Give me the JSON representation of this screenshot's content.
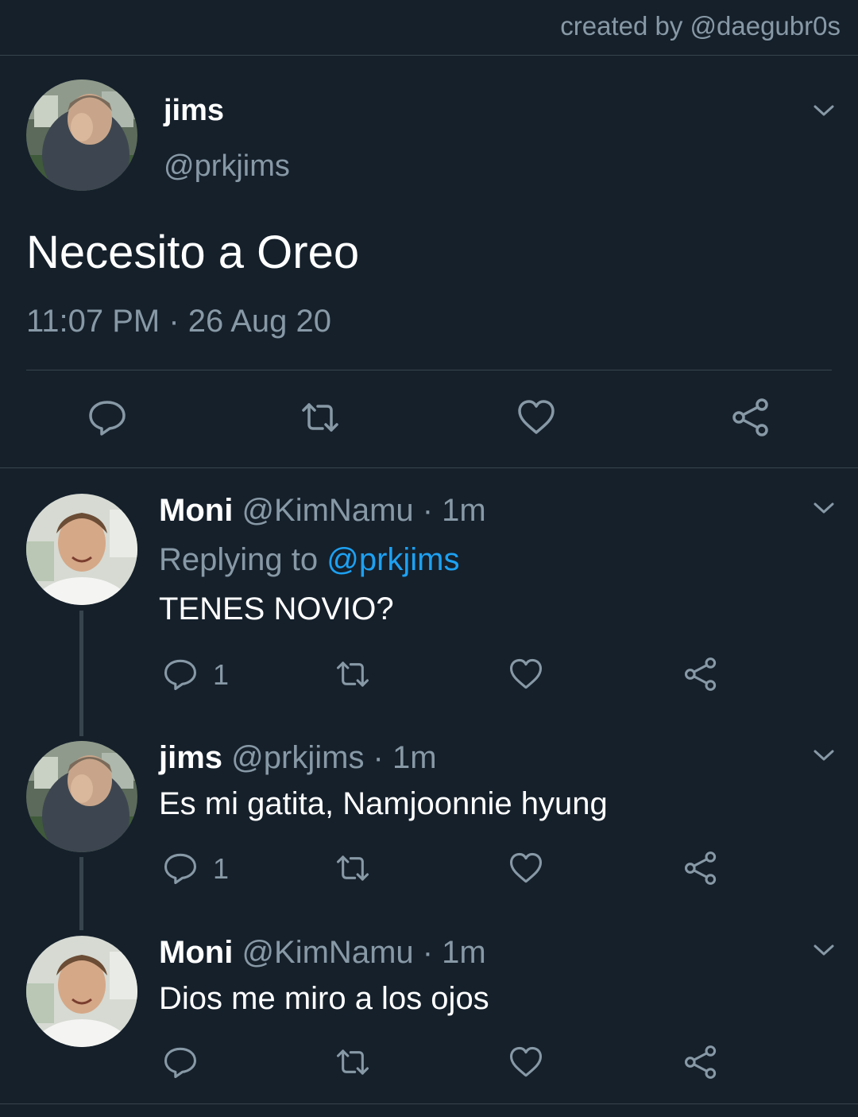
{
  "credit": "created by @daegubr0s",
  "main_tweet": {
    "name": "jims",
    "handle": "@prkjims",
    "text": "Necesito a Oreo",
    "timestamp": "11:07 PM · 26 Aug 20"
  },
  "replies": [
    {
      "name": "Moni",
      "handle_time": "@KimNamu · 1m",
      "replying_prefix": "Replying to ",
      "replying_to": "@prkjims",
      "text": "TENES NOVIO?",
      "reply_count": "1"
    },
    {
      "name": "jims",
      "handle_time": "@prkjims · 1m",
      "text": "Es mi gatita, Namjoonnie hyung",
      "reply_count": "1"
    },
    {
      "name": "Moni",
      "handle_time": "@KimNamu · 1m",
      "text": "Dios me miro a los ojos"
    }
  ],
  "icons": [
    "reply-icon",
    "retweet-icon",
    "like-icon",
    "share-icon",
    "chevron-down-icon"
  ],
  "colors": {
    "background": "#15202b",
    "secondary_text": "#8899a6",
    "link": "#1da1f2",
    "divider": "#38444d"
  }
}
